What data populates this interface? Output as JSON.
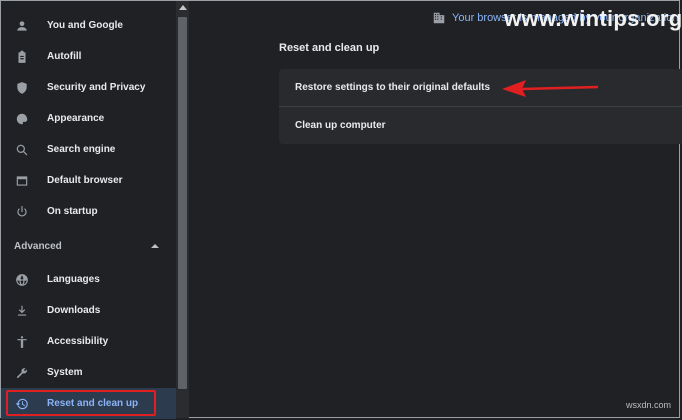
{
  "sidebar": {
    "items": [
      {
        "label": "You and Google",
        "icon": "person-icon"
      },
      {
        "label": "Autofill",
        "icon": "clipboard-icon"
      },
      {
        "label": "Security and Privacy",
        "icon": "shield-icon"
      },
      {
        "label": "Appearance",
        "icon": "palette-icon"
      },
      {
        "label": "Search engine",
        "icon": "search-icon"
      },
      {
        "label": "Default browser",
        "icon": "browser-window-icon"
      },
      {
        "label": "On startup",
        "icon": "power-icon"
      }
    ],
    "advanced_label": "Advanced",
    "advanced_items": [
      {
        "label": "Languages",
        "icon": "globe-icon"
      },
      {
        "label": "Downloads",
        "icon": "download-icon"
      },
      {
        "label": "Accessibility",
        "icon": "accessibility-icon"
      },
      {
        "label": "System",
        "icon": "wrench-icon"
      },
      {
        "label": "Reset and clean up",
        "icon": "restore-icon",
        "active": true
      }
    ]
  },
  "header": {
    "managed_text": "Your browser is managed by your organization",
    "watermark": "www.wintips.org"
  },
  "main": {
    "section_title": "Reset and clean up",
    "rows": [
      {
        "label": "Restore settings to their original defaults"
      },
      {
        "label": "Clean up computer"
      }
    ]
  },
  "footer": {
    "corner_mark": "wsxdn.com"
  },
  "colors": {
    "background": "#202124",
    "card": "#292a2d",
    "accent": "#8ab4f8",
    "annotation_red": "#e02020"
  }
}
